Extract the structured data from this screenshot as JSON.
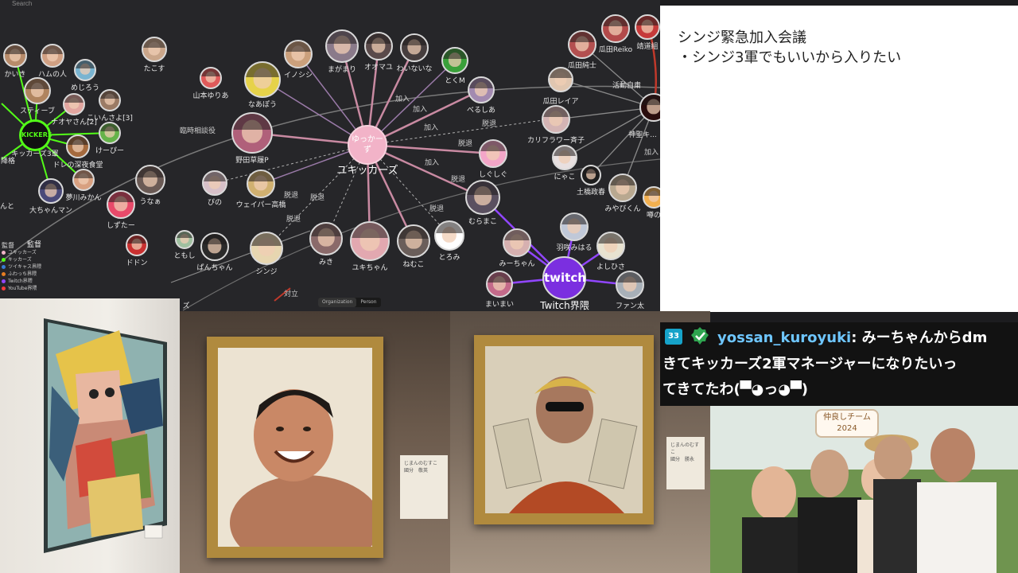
{
  "graph": {
    "search_label": "Search",
    "hubs": {
      "yukkers": "ゆっかーず",
      "yukkers_label": "ユキッカーズ",
      "twitch": "twitch",
      "twitch_label": "Twitch界隈",
      "kickers": "KICKERS",
      "kickers_label": "キッカーズ3軍"
    },
    "nodes": [
      {
        "label": "かいき"
      },
      {
        "label": "ハムの人"
      },
      {
        "label": "たこす"
      },
      {
        "label": "めじろう"
      },
      {
        "label": "スティーブ"
      },
      {
        "label": "ナオヤさん[2]"
      },
      {
        "label": "こいんさよ[3]"
      },
      {
        "label": "けーぴー"
      },
      {
        "label": "ドレの深夜食堂"
      },
      {
        "label": "夢川みかん"
      },
      {
        "label": "大ちゃんマン"
      },
      {
        "label": "しずたー"
      },
      {
        "label": "うなぁ"
      },
      {
        "label": "山本ゆりあ"
      },
      {
        "label": "イノシシ"
      },
      {
        "label": "まがまり"
      },
      {
        "label": "オオマユ"
      },
      {
        "label": "わいないな"
      },
      {
        "label": "とくM"
      },
      {
        "label": "べるしあ"
      },
      {
        "label": "なあぽう"
      },
      {
        "label": "野田草履P"
      },
      {
        "label": "ウェイパー高橋"
      },
      {
        "label": "ぴの"
      },
      {
        "label": "しぐしぐ"
      },
      {
        "label": "むらまこ"
      },
      {
        "label": "みき"
      },
      {
        "label": "ユキちゃん"
      },
      {
        "label": "ねむこ"
      },
      {
        "label": "とろみ"
      },
      {
        "label": "シンジ"
      },
      {
        "label": "ぱんちゃん"
      },
      {
        "label": "ともし"
      },
      {
        "label": "ドドン"
      },
      {
        "label": "みーちゃん"
      },
      {
        "label": "まいまい"
      },
      {
        "label": "羽咲みはる"
      },
      {
        "label": "よしひさ"
      },
      {
        "label": "ファン太"
      },
      {
        "label": "瓜田純士"
      },
      {
        "label": "瓜田Reiko"
      },
      {
        "label": "靖道組"
      },
      {
        "label": "活動自粛"
      },
      {
        "label": "瓜田レイア"
      },
      {
        "label": "神聖キ..."
      },
      {
        "label": "カリフラワー斉子"
      },
      {
        "label": "にゃこ"
      },
      {
        "label": "土橋政春"
      },
      {
        "label": "みやびくん"
      },
      {
        "label": "噂の"
      }
    ],
    "edges": [
      "加入",
      "加入",
      "加入",
      "加入",
      "脱退",
      "脱退",
      "脱退",
      "脱退",
      "脱退",
      "脱退",
      "臨時相談役",
      "脱退",
      "対立",
      "加入",
      "加入"
    ],
    "legend": {
      "title": "監督",
      "subtitle": "監督",
      "items": [
        {
          "name": "ユキッカーズ",
          "color": "#f2b3c8"
        },
        {
          "name": "キッカーズ",
          "color": "#53fc18"
        },
        {
          "name": "ツイキャス界隈",
          "color": "#3a7bd5"
        },
        {
          "name": "ふわっち界隈",
          "color": "#e67e22"
        },
        {
          "name": "Twitch界隈",
          "color": "#9146ff"
        },
        {
          "name": "YouTube界隈",
          "color": "#ff3b3b"
        }
      ]
    },
    "segment": [
      "Organization",
      "Person"
    ],
    "partial_labels": {
      "left1": "降格",
      "left2": "んと",
      "left3": "ズ"
    }
  },
  "slide": {
    "title": "シンジ緊急加入会議",
    "bullet": "・シンジ3軍でもいいから入りたい"
  },
  "chat": {
    "badge": "33",
    "username": "yossan_kuroyuki",
    "line1_message": ": みーちゃんからdm",
    "line2": "きてキッカーズ2軍マネージャーになりたいっ",
    "line3": "てきてたわ(▀◕っ◕▀)"
  },
  "photo": {
    "sign_line1": "仲良しチーム",
    "sign_line2": "2024"
  },
  "plaques": {
    "p2_title": "じまんのむすこ",
    "p2_name": "國分　敬英",
    "p3_title": "じまんのむすこ",
    "p3_name": "國分　勝永"
  }
}
